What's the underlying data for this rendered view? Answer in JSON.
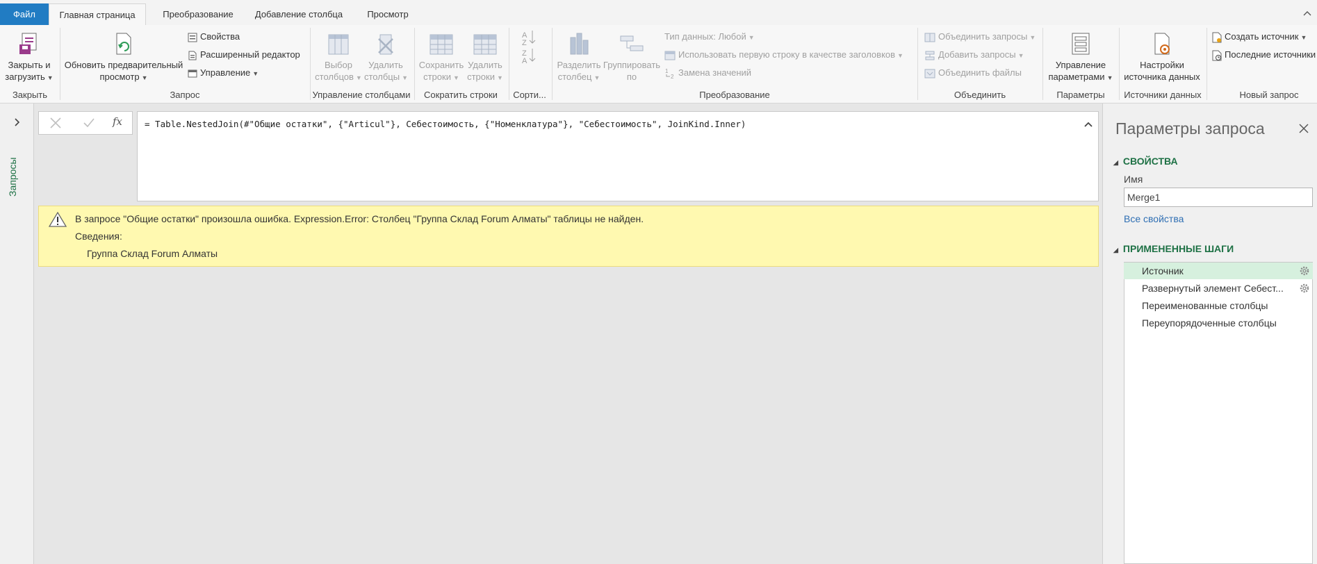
{
  "tabs": {
    "file": "Файл",
    "home": "Главная страница",
    "transform": "Преобразование",
    "add_column": "Добавление столбца",
    "view": "Просмотр"
  },
  "ribbon": {
    "close_load": {
      "line1": "Закрыть и",
      "line2": "загрузить"
    },
    "refresh_preview": {
      "line1": "Обновить предварительный",
      "line2": "просмотр"
    },
    "properties": "Свойства",
    "advanced_editor": "Расширенный редактор",
    "manage": "Управление",
    "choose_columns": {
      "line1": "Выбор",
      "line2": "столбцов"
    },
    "remove_columns": {
      "line1": "Удалить",
      "line2": "столбцы"
    },
    "keep_rows": {
      "line1": "Сохранить",
      "line2": "строки"
    },
    "remove_rows": {
      "line1": "Удалить",
      "line2": "строки"
    },
    "split_column": {
      "line1": "Разделить",
      "line2": "столбец"
    },
    "group_by": {
      "line1": "Группировать",
      "line2": "по"
    },
    "data_type": "Тип данных: Любой",
    "first_row_headers": "Использовать первую строку в качестве заголовков",
    "replace_values": "Замена значений",
    "merge_queries": "Объединить запросы",
    "append_queries": "Добавить запросы",
    "combine_files": "Объединить файлы",
    "manage_params": {
      "line1": "Управление",
      "line2": "параметрами"
    },
    "source_settings": {
      "line1": "Настройки",
      "line2": "источника данных"
    },
    "new_source": "Создать источник",
    "recent_sources": "Последние источники"
  },
  "groups": {
    "close": "Закрыть",
    "query": "Запрос",
    "manage_columns": "Управление столбцами",
    "reduce_rows": "Сократить строки",
    "sort": "Сорти...",
    "transform": "Преобразование",
    "combine": "Объединить",
    "parameters": "Параметры",
    "data_sources": "Источники данных",
    "new_query": "Новый запрос"
  },
  "nav": {
    "queries": "Запросы"
  },
  "formula": {
    "fx": "fx",
    "text": "= Table.NestedJoin(#\"Общие остатки\", {\"Articul\"}, Себестоимость, {\"Номенклатура\"}, \"Себестоимость\", JoinKind.Inner)"
  },
  "error": {
    "message": "В запросе \"Общие остатки\" произошла ошибка. Expression.Error: Столбец \"Группа Склад Forum Алматы\" таблицы не найден.",
    "details_label": "Сведения:",
    "details_value": "Группа Склад Forum Алматы"
  },
  "query_settings": {
    "title": "Параметры запроса",
    "properties_header": "СВОЙСТВА",
    "name_label": "Имя",
    "name_value": "Merge1",
    "all_properties": "Все свойства",
    "applied_steps_header": "ПРИМЕНЕННЫЕ ШАГИ",
    "steps": [
      {
        "label": "Источник",
        "has_gear": true,
        "selected": true
      },
      {
        "label": "Развернутый элемент Себест...",
        "has_gear": true,
        "selected": false
      },
      {
        "label": "Переименованные столбцы",
        "has_gear": false,
        "selected": false
      },
      {
        "label": "Переупорядоченные столбцы",
        "has_gear": false,
        "selected": false
      }
    ]
  },
  "colors": {
    "file_tab": "#217cc3",
    "accent_green": "#1e7145",
    "error_bg": "#fff9b0",
    "selected_step": "#d6f0de",
    "link": "#2f6fb3"
  }
}
